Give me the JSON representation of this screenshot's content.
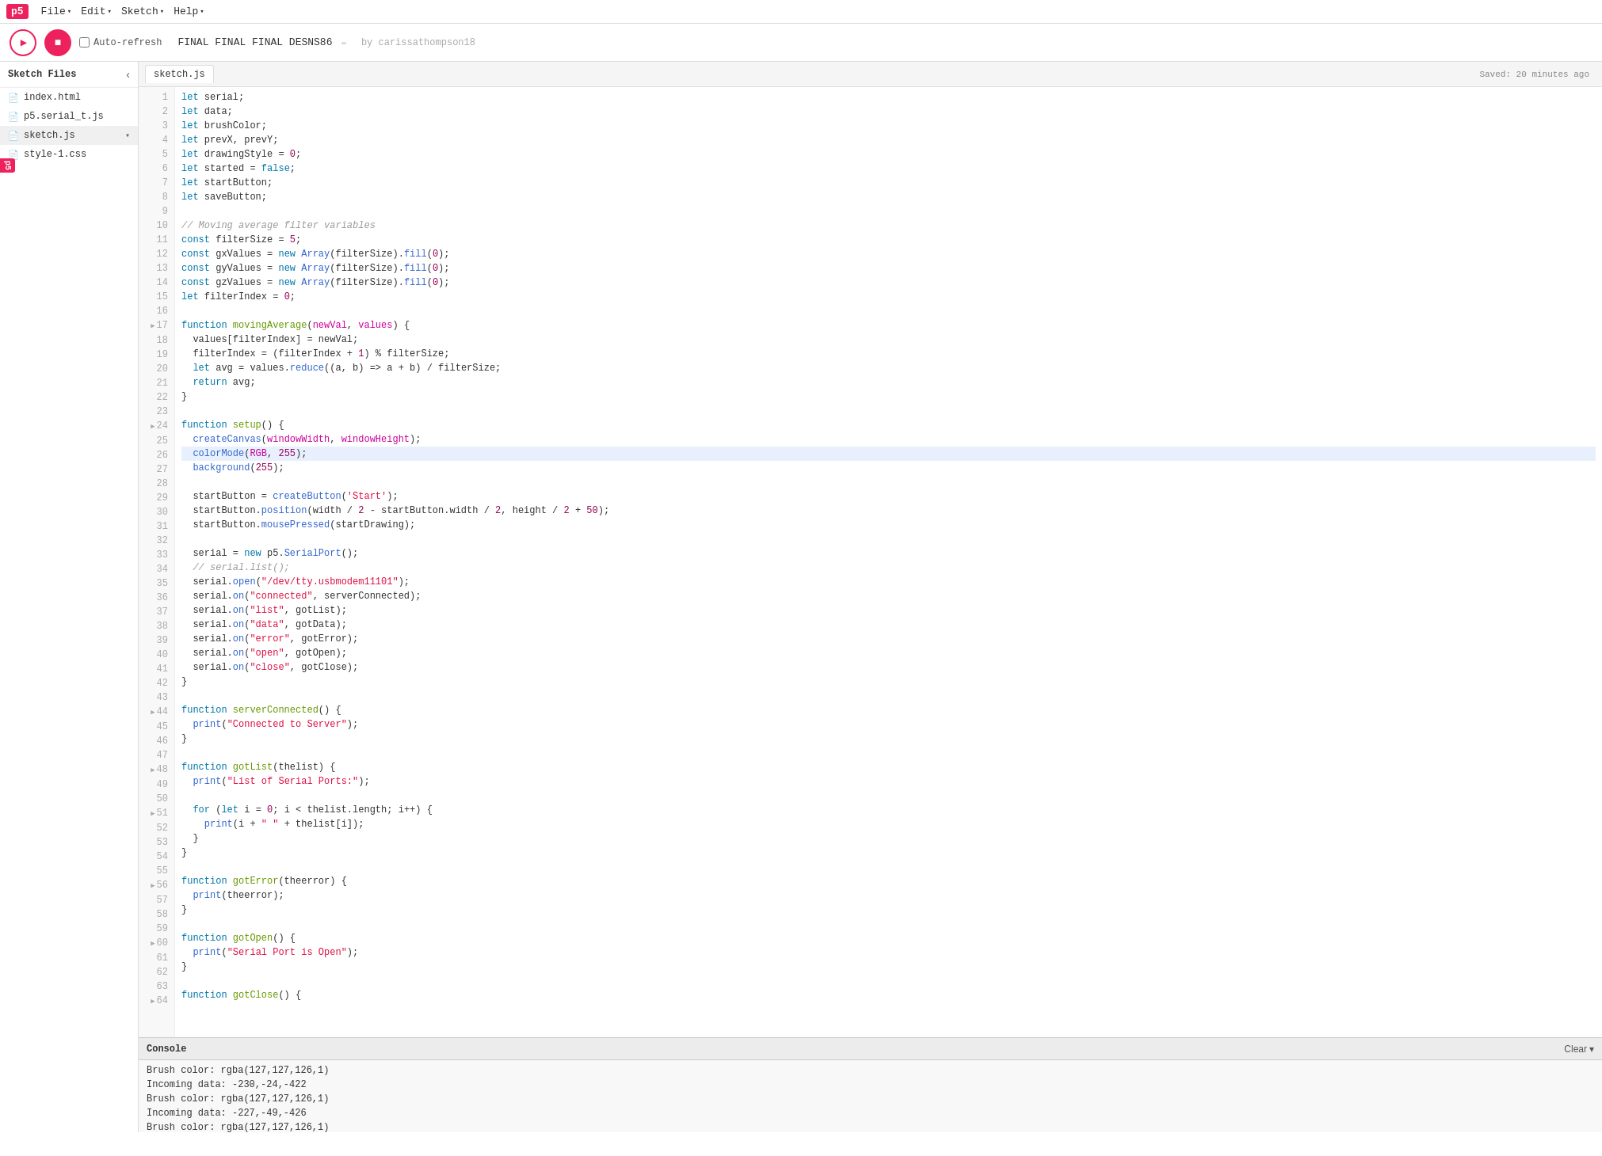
{
  "menubar": {
    "logo": "p5",
    "items": [
      {
        "label": "File",
        "has_arrow": true
      },
      {
        "label": "Edit",
        "has_arrow": true
      },
      {
        "label": "Sketch",
        "has_arrow": true
      },
      {
        "label": "Help",
        "has_arrow": true
      }
    ]
  },
  "toolbar": {
    "play_label": "▶",
    "stop_label": "■",
    "auto_refresh_label": "Auto-refresh",
    "sketch_name": "FINAL FINAL FINAL DESNS86",
    "by_label": "by carissathompson18"
  },
  "sidebar": {
    "title": "Sketch Files",
    "files": [
      {
        "name": "index.html",
        "active": false
      },
      {
        "name": "p5.serial_t.js",
        "active": false
      },
      {
        "name": "sketch.js",
        "active": true
      },
      {
        "name": "style-1.css",
        "active": false
      }
    ]
  },
  "editor": {
    "tab_name": "sketch.js",
    "saved_status": "Saved: 20 minutes ago"
  },
  "code_lines": [
    {
      "num": 1,
      "content": "let serial;",
      "highlight": false
    },
    {
      "num": 2,
      "content": "let data;",
      "highlight": false
    },
    {
      "num": 3,
      "content": "let brushColor;",
      "highlight": false
    },
    {
      "num": 4,
      "content": "let prevX, prevY;",
      "highlight": false
    },
    {
      "num": 5,
      "content": "let drawingStyle = 0;",
      "highlight": false
    },
    {
      "num": 6,
      "content": "let started = false;",
      "highlight": false
    },
    {
      "num": 7,
      "content": "let startButton;",
      "highlight": false
    },
    {
      "num": 8,
      "content": "let saveButton;",
      "highlight": false
    },
    {
      "num": 9,
      "content": "",
      "highlight": false
    },
    {
      "num": 10,
      "content": "// Moving average filter variables",
      "highlight": false
    },
    {
      "num": 11,
      "content": "const filterSize = 5;",
      "highlight": false
    },
    {
      "num": 12,
      "content": "const gxValues = new Array(filterSize).fill(0);",
      "highlight": false
    },
    {
      "num": 13,
      "content": "const gyValues = new Array(filterSize).fill(0);",
      "highlight": false
    },
    {
      "num": 14,
      "content": "const gzValues = new Array(filterSize).fill(0);",
      "highlight": false
    },
    {
      "num": 15,
      "content": "let filterIndex = 0;",
      "highlight": false
    },
    {
      "num": 16,
      "content": "",
      "highlight": false
    },
    {
      "num": 17,
      "content": "function movingAverage(newVal, values) {",
      "highlight": false
    },
    {
      "num": 18,
      "content": "  values[filterIndex] = newVal;",
      "highlight": false
    },
    {
      "num": 19,
      "content": "  filterIndex = (filterIndex + 1) % filterSize;",
      "highlight": false
    },
    {
      "num": 20,
      "content": "  let avg = values.reduce((a, b) => a + b) / filterSize;",
      "highlight": false
    },
    {
      "num": 21,
      "content": "  return avg;",
      "highlight": false
    },
    {
      "num": 22,
      "content": "}",
      "highlight": false
    },
    {
      "num": 23,
      "content": "",
      "highlight": false
    },
    {
      "num": 24,
      "content": "function setup() {",
      "highlight": false
    },
    {
      "num": 25,
      "content": "  createCanvas(windowWidth, windowHeight);",
      "highlight": false
    },
    {
      "num": 26,
      "content": "  colorMode(RGB, 255);",
      "highlight": true
    },
    {
      "num": 27,
      "content": "  background(255);",
      "highlight": false
    },
    {
      "num": 28,
      "content": "",
      "highlight": false
    },
    {
      "num": 29,
      "content": "  startButton = createButton('Start');",
      "highlight": false
    },
    {
      "num": 30,
      "content": "  startButton.position(width / 2 - startButton.width / 2, height / 2 + 50);",
      "highlight": false
    },
    {
      "num": 31,
      "content": "  startButton.mousePressed(startDrawing);",
      "highlight": false
    },
    {
      "num": 32,
      "content": "",
      "highlight": false
    },
    {
      "num": 33,
      "content": "  serial = new p5.SerialPort();",
      "highlight": false
    },
    {
      "num": 34,
      "content": "  // serial.list();",
      "highlight": false
    },
    {
      "num": 35,
      "content": "  serial.open(\"/dev/tty.usbmodem11101\");",
      "highlight": false
    },
    {
      "num": 36,
      "content": "  serial.on(\"connected\", serverConnected);",
      "highlight": false
    },
    {
      "num": 37,
      "content": "  serial.on(\"list\", gotList);",
      "highlight": false
    },
    {
      "num": 38,
      "content": "  serial.on(\"data\", gotData);",
      "highlight": false
    },
    {
      "num": 39,
      "content": "  serial.on(\"error\", gotError);",
      "highlight": false
    },
    {
      "num": 40,
      "content": "  serial.on(\"open\", gotOpen);",
      "highlight": false
    },
    {
      "num": 41,
      "content": "  serial.on(\"close\", gotClose);",
      "highlight": false
    },
    {
      "num": 42,
      "content": "}",
      "highlight": false
    },
    {
      "num": 43,
      "content": "",
      "highlight": false
    },
    {
      "num": 44,
      "content": "function serverConnected() {",
      "highlight": false
    },
    {
      "num": 45,
      "content": "  print(\"Connected to Server\");",
      "highlight": false
    },
    {
      "num": 46,
      "content": "}",
      "highlight": false
    },
    {
      "num": 47,
      "content": "",
      "highlight": false
    },
    {
      "num": 48,
      "content": "function gotList(thelist) {",
      "highlight": false
    },
    {
      "num": 49,
      "content": "  print(\"List of Serial Ports:\");",
      "highlight": false
    },
    {
      "num": 50,
      "content": "",
      "highlight": false
    },
    {
      "num": 51,
      "content": "  for (let i = 0; i < thelist.length; i++) {",
      "highlight": false
    },
    {
      "num": 52,
      "content": "    print(i + \" \" + thelist[i]);",
      "highlight": false
    },
    {
      "num": 53,
      "content": "  }",
      "highlight": false
    },
    {
      "num": 54,
      "content": "}",
      "highlight": false
    },
    {
      "num": 55,
      "content": "",
      "highlight": false
    },
    {
      "num": 56,
      "content": "function gotError(theerror) {",
      "highlight": false
    },
    {
      "num": 57,
      "content": "  print(theerror);",
      "highlight": false
    },
    {
      "num": 58,
      "content": "}",
      "highlight": false
    },
    {
      "num": 59,
      "content": "",
      "highlight": false
    },
    {
      "num": 60,
      "content": "function gotOpen() {",
      "highlight": false
    },
    {
      "num": 61,
      "content": "  print(\"Serial Port is Open\");",
      "highlight": false
    },
    {
      "num": 62,
      "content": "}",
      "highlight": false
    },
    {
      "num": 63,
      "content": "",
      "highlight": false
    },
    {
      "num": 64,
      "content": "function gotClose() {",
      "highlight": false
    }
  ],
  "console": {
    "title": "Console",
    "clear_label": "Clear",
    "chevron_label": "▾",
    "lines": [
      "Brush color: rgba(127,127,126,1)",
      "Incoming data: -230,-24,-422",
      "Brush color: rgba(127,127,126,1)",
      "Incoming data: -227,-49,-426",
      "Brush color: rgba(127,127,126,1)"
    ]
  }
}
